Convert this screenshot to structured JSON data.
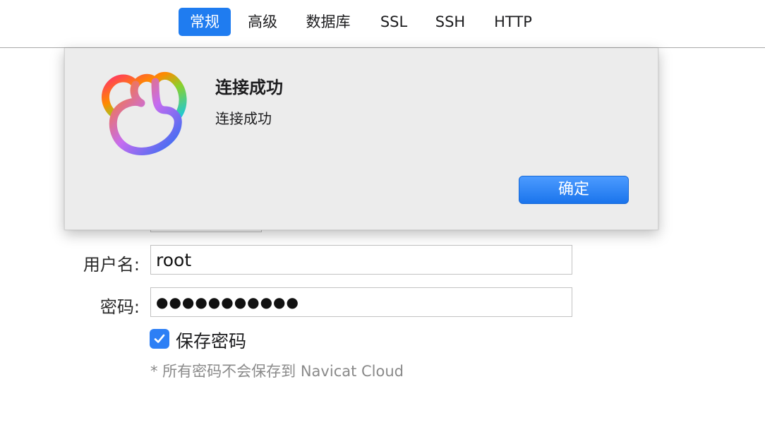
{
  "tabs": [
    {
      "label": "常规",
      "active": true
    },
    {
      "label": "高级",
      "active": false
    },
    {
      "label": "数据库",
      "active": false
    },
    {
      "label": "SSL",
      "active": false
    },
    {
      "label": "SSH",
      "active": false
    },
    {
      "label": "HTTP",
      "active": false
    }
  ],
  "form": {
    "username_label": "用户名:",
    "username_value": "root",
    "password_label": "密码:",
    "password_value": "●●●●●●●●●●●",
    "save_password_label": "保存密码",
    "save_password_checked": true,
    "note": "* 所有密码不会保存到 Navicat Cloud"
  },
  "dialog": {
    "icon": "navicat-logo-icon",
    "title": "连接成功",
    "message": "连接成功",
    "ok_label": "确定"
  },
  "colors": {
    "accent": "#1f7cf0",
    "dialog_bg": "#ececec",
    "checkbox": "#2d7ff5"
  }
}
